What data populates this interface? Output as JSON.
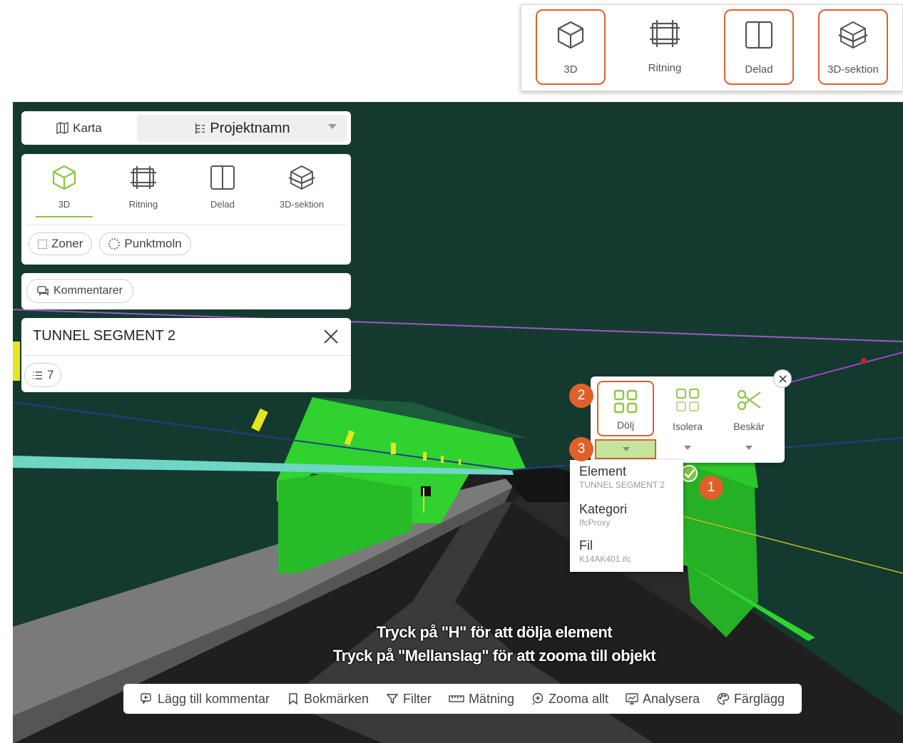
{
  "view_switcher_callout": {
    "buttons": [
      {
        "label": "3D",
        "icon": "cube-icon",
        "highlighted": true
      },
      {
        "label": "Ritning",
        "icon": "drawing-icon",
        "highlighted": false
      },
      {
        "label": "Delad",
        "icon": "split-view-icon",
        "highlighted": true
      },
      {
        "label": "3D-sektion",
        "icon": "section-cube-icon",
        "highlighted": true
      }
    ]
  },
  "header": {
    "map_tab": "Karta",
    "project_tab": "Projektnamn"
  },
  "view_panel": {
    "buttons": [
      {
        "label": "3D",
        "active": true
      },
      {
        "label": "Ritning",
        "active": false
      },
      {
        "label": "Delad",
        "active": false
      },
      {
        "label": "3D-sektion",
        "active": false
      }
    ],
    "chips": {
      "zones": "Zoner",
      "point_cloud": "Punktmoln"
    }
  },
  "comments_chip": "Kommentarer",
  "selection_panel": {
    "title": "TUNNEL SEGMENT 2",
    "count": "7"
  },
  "context_menu": {
    "actions": [
      {
        "label": "Dölj",
        "icon": "hide-grid-icon"
      },
      {
        "label": "Isolera",
        "icon": "isolate-grid-icon"
      },
      {
        "label": "Beskär",
        "icon": "scissors-icon"
      }
    ]
  },
  "hide_dropdown": {
    "items": [
      {
        "title": "Element",
        "sub": "TUNNEL SEGMENT 2"
      },
      {
        "title": "Kategori",
        "sub": "IfcProxy"
      },
      {
        "title": "Fil",
        "sub": "K14AK401.ifc"
      }
    ]
  },
  "step_badges": [
    "1",
    "2",
    "3"
  ],
  "hints": {
    "line1": "Tryck på \"H\" för att dölja element",
    "line2": "Tryck på \"Mellanslag\" för att zooma till objekt"
  },
  "toolbar": {
    "add_comment": "Lägg till kommentar",
    "bookmarks": "Bokmärken",
    "filter": "Filter",
    "measure": "Mätning",
    "zoom_all": "Zooma allt",
    "analyze": "Analysera",
    "colorize": "Färglägg"
  },
  "colors": {
    "accent_green": "#8dc63f",
    "highlight_orange": "#e0602a",
    "viewport_bg": "#143a2f",
    "tunnel_green": "#2fd22f"
  }
}
